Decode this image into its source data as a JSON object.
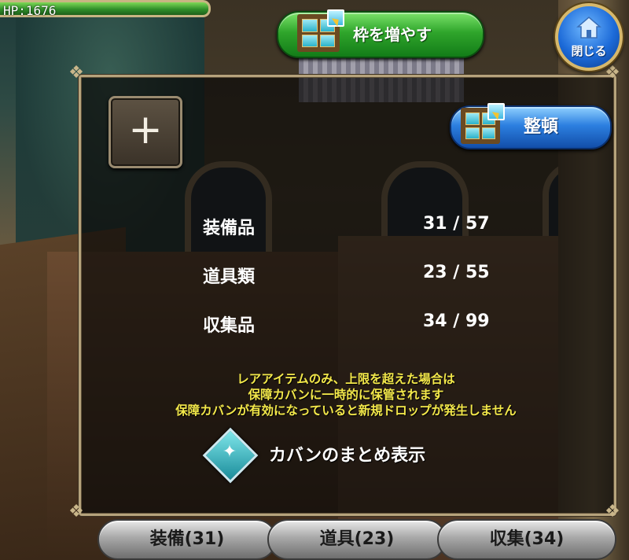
{
  "hud": {
    "hp_text": "HP:1676"
  },
  "header": {
    "expand_button_label": "枠を増やす",
    "close_button_label": "閉じる"
  },
  "inventory": {
    "sort_button_label": "整頓",
    "add_button_glyph": "+",
    "rows": [
      {
        "label": "装備品",
        "count": "31 / 57"
      },
      {
        "label": "道具類",
        "count": "23 / 55"
      },
      {
        "label": "収集品",
        "count": "34 / 99"
      }
    ],
    "notice_lines": [
      "レアアイテムのみ、上限を超えた場合は",
      "保障カバンに一時的に保管されます",
      "保障カバンが有効になっていると新規ドロップが発生しません"
    ],
    "summary_toggle_label": "カバンのまとめ表示"
  },
  "tabs": [
    {
      "label": "装備(31)"
    },
    {
      "label": "道具(23)"
    },
    {
      "label": "収集(34)"
    }
  ],
  "icons": {
    "grid": "grid-expand-icon",
    "home": "home-icon",
    "plus": "plus-icon",
    "sparkle": "sparkle-diamond-icon"
  },
  "colors": {
    "hp_bar": "#2f8f2a",
    "expand_button": "#2fa52b",
    "sort_button": "#2c7fe0",
    "close_button": "#1c6ad8",
    "notice_text": "#f3e84a",
    "tab": "#a8a8a8"
  }
}
